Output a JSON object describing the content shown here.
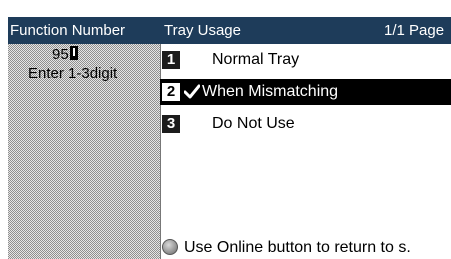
{
  "function_panel": {
    "header": "Function Number",
    "value": "95",
    "hint": "Enter 1-3digit"
  },
  "menu": {
    "title": "Tray Usage",
    "page": "1/1 Page",
    "items": [
      {
        "number": "1",
        "label": "Normal Tray",
        "checked": false,
        "selected": false
      },
      {
        "number": "2",
        "label": "When Mismatching",
        "checked": true,
        "selected": true
      },
      {
        "number": "3",
        "label": "Do Not Use",
        "checked": false,
        "selected": false
      }
    ]
  },
  "footer": {
    "text": "Use Online button to return to s.",
    "icon": "online-button-icon"
  },
  "colors": {
    "header_bg": "#1e3c5a",
    "selected_bg": "#000000"
  }
}
